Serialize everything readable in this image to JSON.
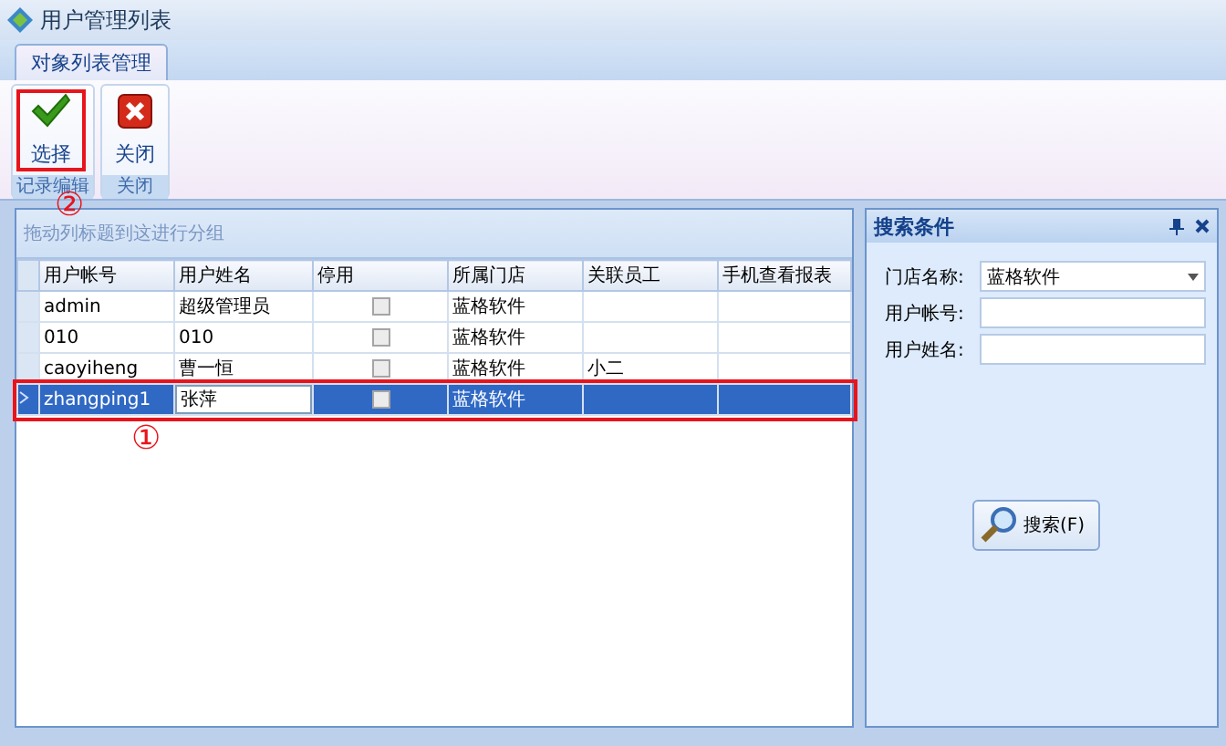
{
  "window": {
    "title": "用户管理列表"
  },
  "tabs": [
    {
      "label": "对象列表管理",
      "selected": true
    }
  ],
  "ribbon": {
    "groups": [
      {
        "label": "记录编辑",
        "buttons": [
          {
            "label": "选择",
            "kind": "check",
            "highlighted": true
          }
        ]
      },
      {
        "label": "关闭",
        "buttons": [
          {
            "label": "关闭",
            "kind": "close",
            "highlighted": false
          }
        ]
      }
    ]
  },
  "grid": {
    "group_hint": "拖动列标题到这进行分组",
    "columns": [
      "用户帐号",
      "用户姓名",
      "停用",
      "所属门店",
      "关联员工",
      "手机查看报表"
    ],
    "rows": [
      {
        "account": "admin",
        "name": "超级管理员",
        "disabled": false,
        "store": "蓝格软件",
        "selected": false
      },
      {
        "account": "010",
        "name": "010",
        "disabled": false,
        "store": "蓝格软件",
        "selected": false
      },
      {
        "account": "caoyiheng",
        "name": "曹一恒",
        "disabled": false,
        "store": "蓝格软件",
        "employee": "小二",
        "selected": false
      },
      {
        "account": "zhangping1",
        "name": "张萍",
        "disabled": false,
        "store": "蓝格软件",
        "selected": true,
        "highlighted": true
      }
    ]
  },
  "search_panel": {
    "title": "搜索条件",
    "fields": [
      {
        "label": "门店名称:",
        "kind": "dropdown",
        "value": "蓝格软件"
      },
      {
        "label": "用户帐号:",
        "kind": "text"
      },
      {
        "label": "用户姓名:",
        "kind": "text"
      }
    ],
    "button": "搜索(F)"
  },
  "annotations": [
    "②",
    "①"
  ]
}
